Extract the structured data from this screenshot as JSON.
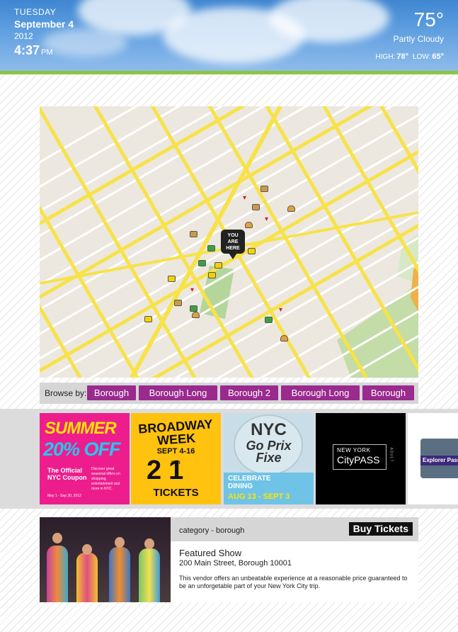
{
  "weather": {
    "day": "TUESDAY",
    "date": "September 4",
    "year": "2012",
    "time": "4:37",
    "ampm": "PM",
    "temperature": "75°",
    "condition": "Partly Cloudy",
    "high_label": "HIGH:",
    "high": "78°",
    "low_label": "LOW:",
    "low": "65°"
  },
  "map": {
    "marker_line1": "YOU",
    "marker_line2": "ARE",
    "marker_line3": "HERE",
    "poi_icons": [
      "burger-icon",
      "ticket-icon",
      "money-icon",
      "shopping-bag-icon",
      "cocktail-icon"
    ]
  },
  "browse": {
    "label": "Browse by:",
    "buttons": [
      "Borough",
      "Borough Long",
      "Borough 2",
      "Borough Long",
      "Borough"
    ]
  },
  "coupons": {
    "summer": {
      "title": "SUMMER",
      "offer": "20% OFF",
      "name": "The Official NYC Coupon",
      "detail": "Discover great seasonal offers on shopping, entertainment and more in NYC.",
      "dates": "May 1 - Sep 30, 2012"
    },
    "broadway": {
      "title_line1": "BROADWAY",
      "title_line2": "WEEK",
      "dates": "SEPT 4-16",
      "big": "21",
      "for_text": "FOR",
      "tickets": "TICKETS"
    },
    "prix_fixe": {
      "title_line1": "NYC",
      "title_line2": "Go Prix",
      "title_line3": "Fixe",
      "caption_line1": "CELEBRATE",
      "caption_line2": "DINING",
      "dates": "AUG 13 - SEPT 3"
    },
    "citypass": {
      "line1": "NEW YORK",
      "line2": "CityPASS",
      "side": "ADULT"
    },
    "explorer": {
      "label": "Explorer Pass"
    }
  },
  "featured": {
    "category": "category - borough",
    "buy_label": "Buy Tickets",
    "title": "Featured Show",
    "address": "200 Main Street, Borough 10001",
    "description": "This vendor offers an unbeatable experience at a reasonable price guaranteed to be an unforgetable part of your New York City trip."
  },
  "colors": {
    "browse_button": "#9a2a8e",
    "accent_green": "#8cc63f",
    "sky_blue": "#4a8fd8"
  }
}
